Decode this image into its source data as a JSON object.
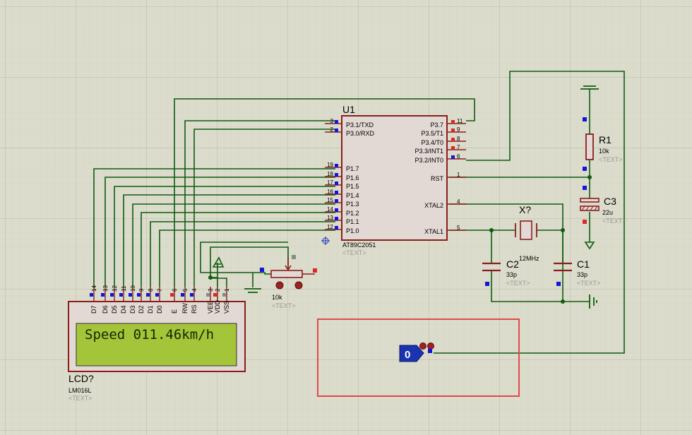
{
  "u1": {
    "ref": "U1",
    "part": "AT89C2051",
    "text_tag": "<TEXT>",
    "left_pins": [
      {
        "num": "3",
        "label": "P3.1/TXD"
      },
      {
        "num": "2",
        "label": "P3.0/RXD"
      },
      {
        "num": "19",
        "label": "P1.7"
      },
      {
        "num": "18",
        "label": "P1.6"
      },
      {
        "num": "17",
        "label": "P1.5"
      },
      {
        "num": "16",
        "label": "P1.4"
      },
      {
        "num": "15",
        "label": "P1.3"
      },
      {
        "num": "14",
        "label": "P1.2"
      },
      {
        "num": "13",
        "label": "P1.1"
      },
      {
        "num": "12",
        "label": "P1.0"
      }
    ],
    "right_pins": [
      {
        "num": "11",
        "label": "P3.7"
      },
      {
        "num": "9",
        "label": "P3.5/T1"
      },
      {
        "num": "8",
        "label": "P3.4/T0"
      },
      {
        "num": "7",
        "label": "P3.3/INT1"
      },
      {
        "num": "6",
        "label": "P3.2/INT0"
      },
      {
        "num": "1",
        "label": "RST"
      },
      {
        "num": "4",
        "label": "XTAL2"
      },
      {
        "num": "5",
        "label": "XTAL1"
      }
    ]
  },
  "lcd": {
    "ref": "LCD?",
    "part": "LM016L",
    "text_tag": "<TEXT>",
    "display_text": "Speed 011.46km/h",
    "pins": [
      {
        "num": "14",
        "label": "D7"
      },
      {
        "num": "13",
        "label": "D6"
      },
      {
        "num": "12",
        "label": "D5"
      },
      {
        "num": "11",
        "label": "D4"
      },
      {
        "num": "10",
        "label": "D3"
      },
      {
        "num": "9",
        "label": "D2"
      },
      {
        "num": "8",
        "label": "D1"
      },
      {
        "num": "7",
        "label": "D0"
      },
      {
        "num": "6",
        "label": "E"
      },
      {
        "num": "5",
        "label": "RW"
      },
      {
        "num": "4",
        "label": "RS"
      },
      {
        "num": "3",
        "label": "VEE"
      },
      {
        "num": "2",
        "label": "VDD"
      },
      {
        "num": "1",
        "label": "VSS"
      }
    ]
  },
  "pot": {
    "value": "10k",
    "text_tag": "<TEXT>"
  },
  "r1": {
    "ref": "R1",
    "value": "10k",
    "text_tag": "<TEXT>"
  },
  "c3": {
    "ref": "C3",
    "value": "22u",
    "text_tag": "<TEXT>"
  },
  "c2": {
    "ref": "C2",
    "value": "33p",
    "text_tag": "<TEXT>"
  },
  "c1": {
    "ref": "C1",
    "value": "33p",
    "text_tag": "<TEXT>"
  },
  "crystal": {
    "ref": "X?",
    "value": "12MHz"
  },
  "logic_probe": {
    "value": "0"
  },
  "colors": {
    "background": "#dcdccc",
    "grid": "#c6c6b4",
    "wire": "#0e5c0e",
    "component": "#8a1e1e",
    "component_fill": "#e2d8d4",
    "lcd_screen": "#a4c43a",
    "pin_marker": "#1414dc",
    "pin_marker_red": "#dc2828",
    "probe": "#1a34b0",
    "selection_box": "#e04a4a"
  }
}
